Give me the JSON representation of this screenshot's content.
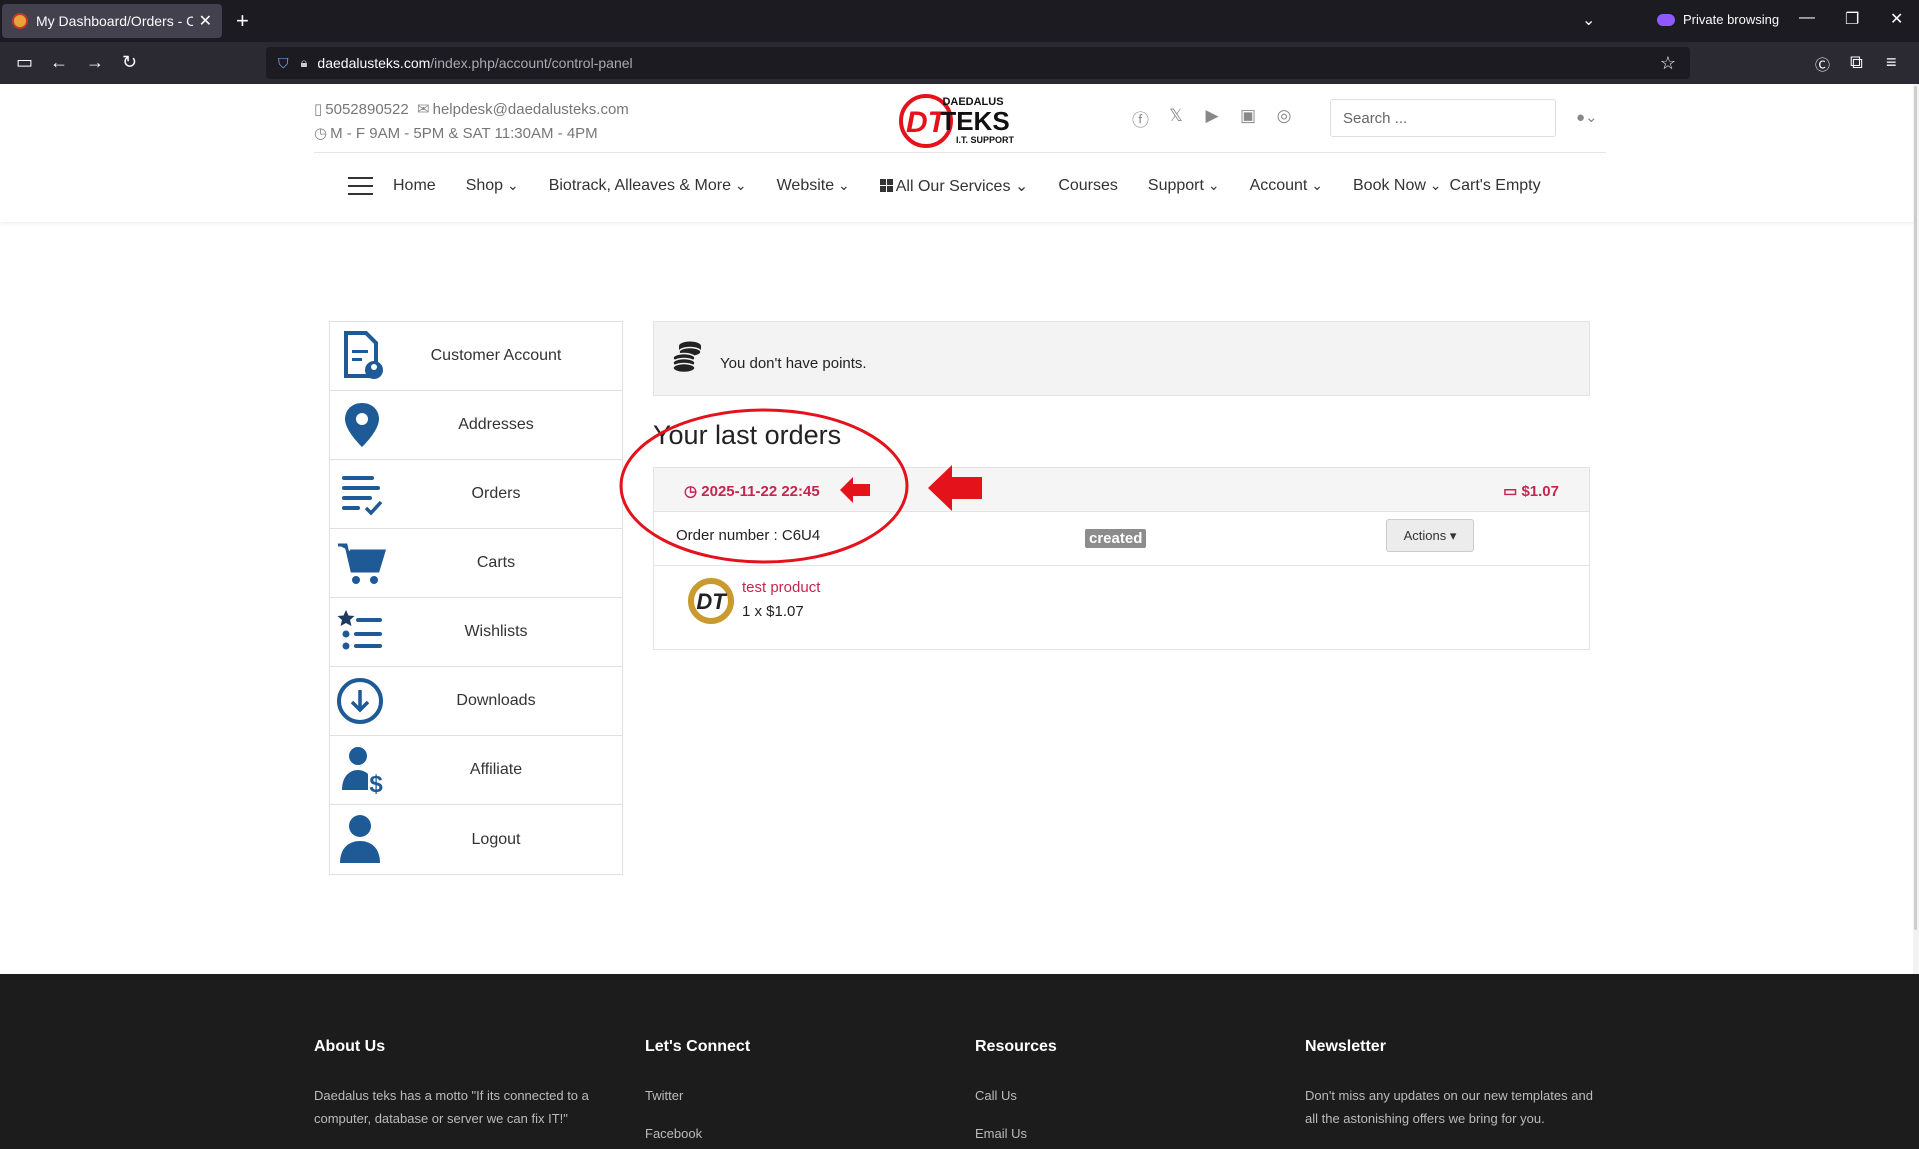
{
  "browser": {
    "tab_title": "My Dashboard/Orders - Compu",
    "url_host": "daedalusteks.com",
    "url_path": "/index.php/account/control-panel",
    "private_label": "Private browsing"
  },
  "header": {
    "phone": "5052890522",
    "email": "helpdesk@daedalusteks.com",
    "hours": "M - F 9AM - 5PM & SAT 11:30AM - 4PM",
    "logo_text_top": "DAEDALUS",
    "logo_text_main": "TEKS",
    "logo_text_sub": "I.T. SUPPORT",
    "logo_mark": "DT",
    "search_placeholder": "Search ...",
    "social": [
      "facebook-icon",
      "x-icon",
      "youtube-icon",
      "linkedin-icon",
      "instagram-icon"
    ]
  },
  "nav": {
    "items": [
      {
        "label": "Home"
      },
      {
        "label": "Shop"
      },
      {
        "label": "Biotrack, Alleaves & More"
      },
      {
        "label": "Website"
      },
      {
        "label": "All Our Services"
      },
      {
        "label": "Courses"
      },
      {
        "label": "Support"
      },
      {
        "label": "Account"
      },
      {
        "label": "Book Now"
      },
      {
        "label": "Cart's Empty"
      }
    ]
  },
  "sidebar": {
    "items": [
      {
        "label": "Customer Account",
        "icon": "customer-account-icon"
      },
      {
        "label": "Addresses",
        "icon": "map-pin-icon"
      },
      {
        "label": "Orders",
        "icon": "orders-list-icon"
      },
      {
        "label": "Carts",
        "icon": "cart-icon"
      },
      {
        "label": "Wishlists",
        "icon": "wishlist-icon"
      },
      {
        "label": "Downloads",
        "icon": "download-icon"
      },
      {
        "label": "Affiliate",
        "icon": "affiliate-icon"
      },
      {
        "label": "Logout",
        "icon": "user-icon"
      }
    ]
  },
  "points": {
    "text": "You don't have points."
  },
  "orders": {
    "title": "Your last orders",
    "order": {
      "date": "2025-11-22 22:45",
      "total": "$1.07",
      "number_label": "Order number : C6U4",
      "status": "created",
      "actions_label": "Actions",
      "product_name": "test product",
      "product_qty": "1 x $1.07"
    }
  },
  "colors": {
    "accent": "#c7254e",
    "icon_blue": "#1e5a96",
    "annotation_red": "#e3121b",
    "footer_bg": "#1c1c1c"
  },
  "footer": {
    "about_title": "About Us",
    "about_text": "Daedalus teks has a motto \"If its connected to a computer, database or server we can fix IT!\"",
    "connect_title": "Let's Connect",
    "connect_links": [
      "Twitter",
      "Facebook"
    ],
    "resources_title": "Resources",
    "resources_links": [
      "Call Us",
      "Email Us"
    ],
    "newsletter_title": "Newsletter",
    "newsletter_text": "Don't miss any updates on our new templates and all the astonishing offers we bring for you."
  }
}
